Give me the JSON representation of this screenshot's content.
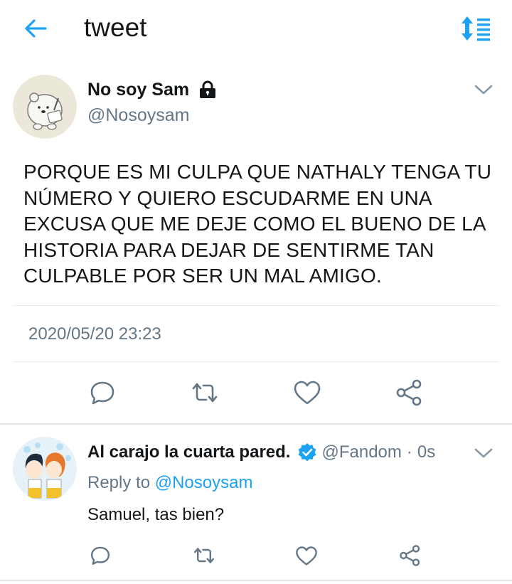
{
  "header": {
    "title": "tweet",
    "back_icon": "arrow-left-icon",
    "sort_icon": "sort-icon"
  },
  "accent": "#1da1f2",
  "tweet": {
    "name": "No soy Sam",
    "handle": "@Nosoysam",
    "lock_icon": "lock-icon",
    "text": "PORQUE ES MI CULPA QUE NATHALY TENGA TU NÚMERO Y QUIERO ESCUDARME EN UNA EXCUSA QUE ME DEJE COMO EL BUENO DE LA HISTORIA PARA DEJAR DE SENTIRME TAN CULPABLE POR SER UN MAL AMIGO.",
    "timestamp": "2020/05/20 23:23"
  },
  "reply": {
    "name": "Al carajo la cuarta pared.",
    "handle": "@Fandom",
    "separator": "·",
    "time": "0s",
    "reply_to_prefix": "Reply to",
    "reply_to_handle": "@Nosoysam",
    "text": "Samuel, tas bien?"
  },
  "actions": [
    "reply-icon",
    "retweet-icon",
    "like-icon",
    "share-icon"
  ]
}
